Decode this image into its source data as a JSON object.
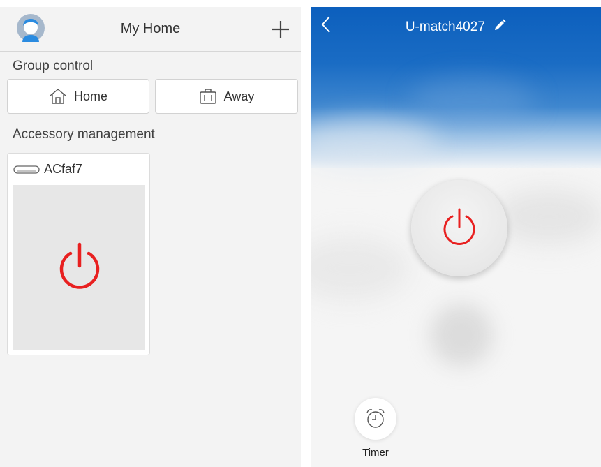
{
  "left_panel": {
    "header": {
      "title": "My Home",
      "add_icon": "plus-icon",
      "avatar_icon": "user-avatar-icon"
    },
    "group_control": {
      "heading": "Group control",
      "buttons": [
        {
          "label": "Home",
          "icon": "house-icon"
        },
        {
          "label": "Away",
          "icon": "suitcase-icon"
        }
      ]
    },
    "accessory_management": {
      "heading": "Accessory management",
      "devices": [
        {
          "name": "ACfaf7",
          "icon": "air-conditioner-icon",
          "power_icon": "power-icon"
        }
      ]
    }
  },
  "right_panel": {
    "header": {
      "title": "U-match4027",
      "back_icon": "chevron-left-icon",
      "edit_icon": "pencil-icon"
    },
    "power_icon": "power-icon",
    "timer": {
      "label": "Timer",
      "icon": "alarm-clock-icon"
    }
  },
  "colors": {
    "power_red": "#e82020",
    "sky_blue": "#0c5fbd",
    "panel_bg": "#f3f3f3"
  }
}
